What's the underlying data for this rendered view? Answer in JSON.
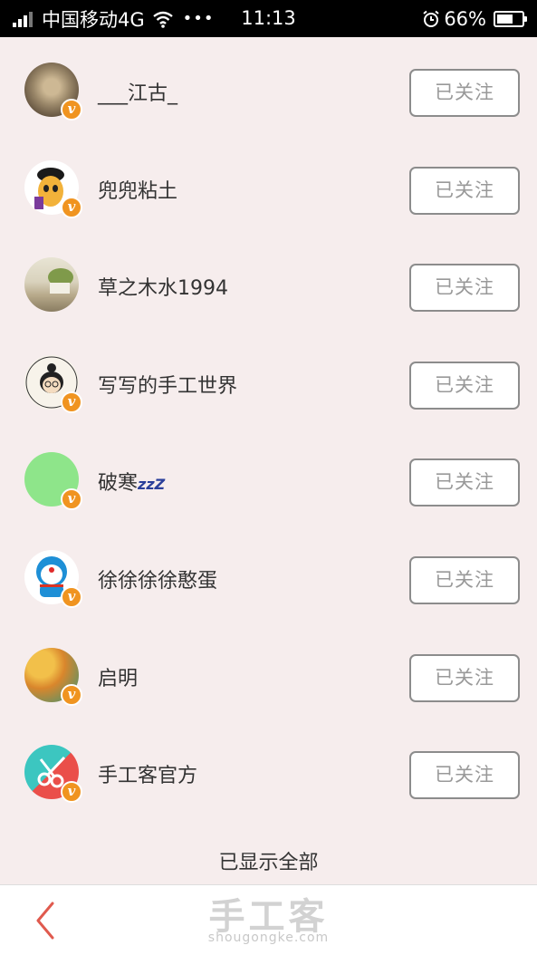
{
  "status_bar": {
    "carrier": "中国移动4G",
    "dots": "•••",
    "time": "11:13",
    "battery_percent": "66%",
    "battery_level": 0.66,
    "icons": [
      "signal-icon",
      "wifi-icon",
      "alarm-icon",
      "battery-icon"
    ]
  },
  "follow_list": [
    {
      "name": "___江古_",
      "button": "已关注",
      "verified": true
    },
    {
      "name": "兜兜粘土",
      "button": "已关注",
      "verified": true
    },
    {
      "name": "草之木水1994",
      "button": "已关注",
      "verified": false
    },
    {
      "name": "写写的手工世界",
      "button": "已关注",
      "verified": true
    },
    {
      "name": "破寒",
      "name_suffix": "zzZ",
      "button": "已关注",
      "verified": true
    },
    {
      "name": "徐徐徐徐憨蛋",
      "button": "已关注",
      "verified": true
    },
    {
      "name": "启明",
      "button": "已关注",
      "verified": true
    },
    {
      "name": "手工客官方",
      "button": "已关注",
      "verified": true
    }
  ],
  "footer_note": "已显示全部",
  "bottom_bar": {
    "logo": "手工客",
    "url": "shougongke.com"
  },
  "colors": {
    "background": "#f6eded",
    "badge": "#f09420",
    "back_arrow": "#e05a4e"
  }
}
